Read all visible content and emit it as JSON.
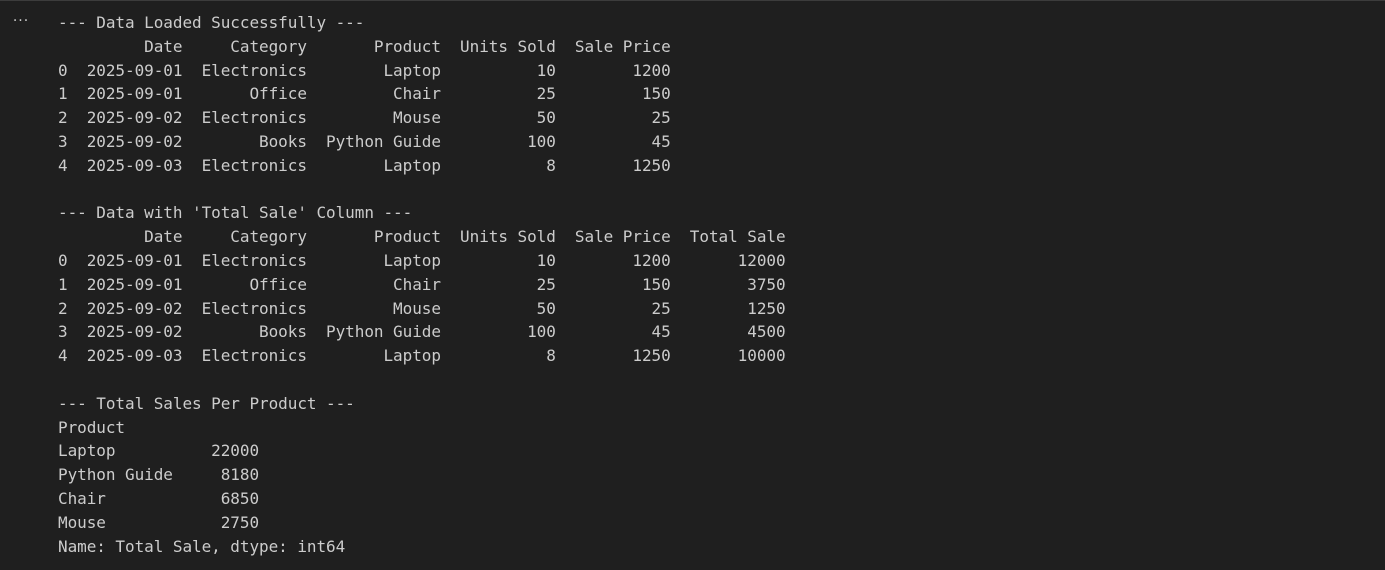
{
  "cell_toolbar": {
    "more_icon": "ellipsis-icon",
    "more_label": "···"
  },
  "output": {
    "lines": [
      "--- Data Loaded Successfully ---",
      "         Date     Category       Product  Units Sold  Sale Price",
      "0  2025-09-01  Electronics        Laptop          10        1200",
      "1  2025-09-01       Office         Chair          25         150",
      "2  2025-09-02  Electronics         Mouse          50          25",
      "3  2025-09-02        Books  Python Guide         100          45",
      "4  2025-09-03  Electronics        Laptop           8        1250",
      "",
      "--- Data with 'Total Sale' Column ---",
      "         Date     Category       Product  Units Sold  Sale Price  Total Sale",
      "0  2025-09-01  Electronics        Laptop          10        1200       12000",
      "1  2025-09-01       Office         Chair          25         150        3750",
      "2  2025-09-02  Electronics         Mouse          50          25        1250",
      "3  2025-09-02        Books  Python Guide         100          45        4500",
      "4  2025-09-03  Electronics        Laptop           8        1250       10000",
      "",
      "--- Total Sales Per Product ---",
      "Product",
      "Laptop          22000",
      "Python Guide     8180",
      "Chair            6850",
      "Mouse            2750",
      "Name: Total Sale, dtype: int64"
    ]
  },
  "colors": {
    "background": "#1f1f1f",
    "text": "#cccccc",
    "border": "#3c3c3c"
  }
}
